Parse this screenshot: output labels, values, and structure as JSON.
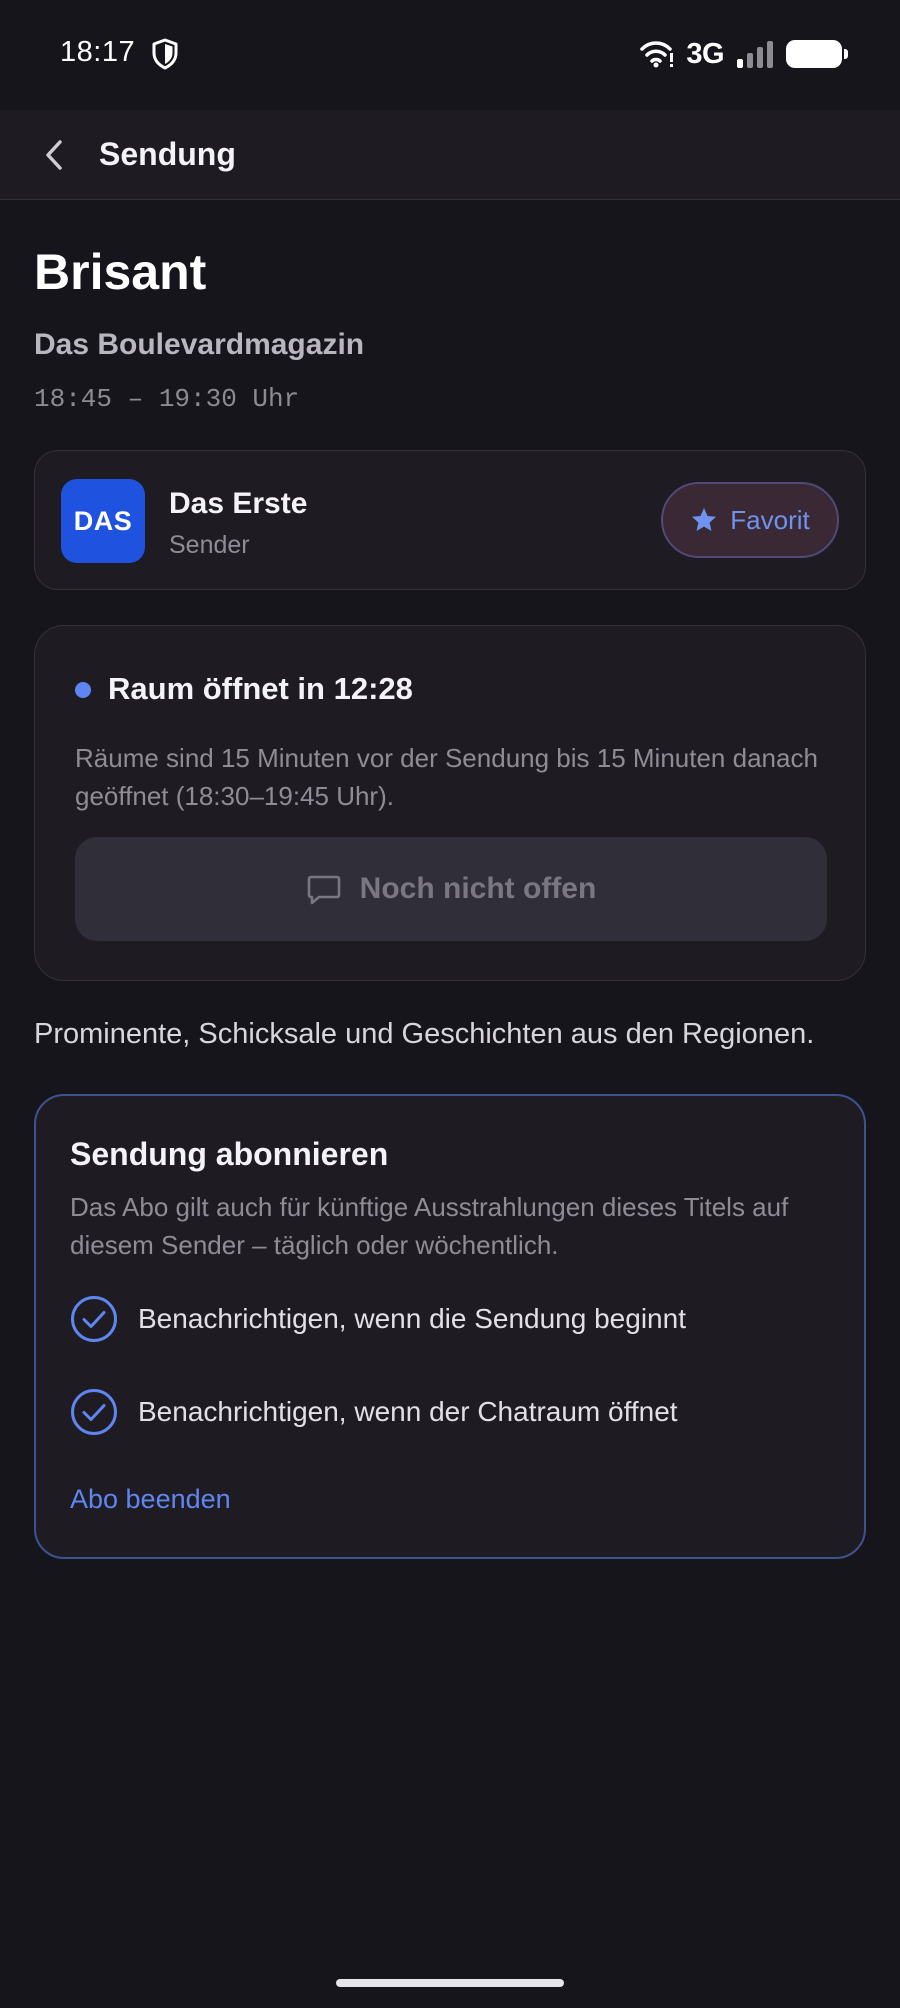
{
  "status_bar": {
    "time": "18:17",
    "network": "3G",
    "icons": [
      "shield-icon",
      "wifi-icon",
      "signal-icon",
      "battery-icon"
    ]
  },
  "app_bar": {
    "back_icon": "chevron-left-icon",
    "title": "Sendung"
  },
  "show": {
    "title": "Brisant",
    "subtitle": "Das Boulevardmagazin",
    "time": "18:45 – 19:30 Uhr"
  },
  "channel": {
    "logo_text": "DAS",
    "name": "Das Erste",
    "role": "Sender",
    "favorite_label": "Favorit",
    "favorite_icon": "star-icon",
    "logo_color": "#2052e0"
  },
  "room": {
    "status": "Raum öffnet in 12:28",
    "info": "Räume sind 15 Minuten vor der Sendung bis 15 Minuten danach geöffnet (18:30–19:45 Uhr).",
    "button_label": "Noch nicht offen",
    "button_icon": "chat-bubble-icon"
  },
  "description": "Prominente, Schicksale und Geschichten aus den Regionen.",
  "subscription": {
    "title": "Sendung abonnieren",
    "info": "Das Abo gilt auch für künftige Ausstrahlungen dieses Titels auf diesem Sender – täglich oder wöchentlich.",
    "options": [
      {
        "label": "Benachrichtigen, wenn die Sendung beginnt",
        "checked": true
      },
      {
        "label": "Benachrichtigen, wenn der Chatraum öffnet",
        "checked": true
      }
    ],
    "end_label": "Abo beenden"
  },
  "colors": {
    "background": "#16151b",
    "card": "#1e1c22",
    "accent": "#5f86f0"
  }
}
